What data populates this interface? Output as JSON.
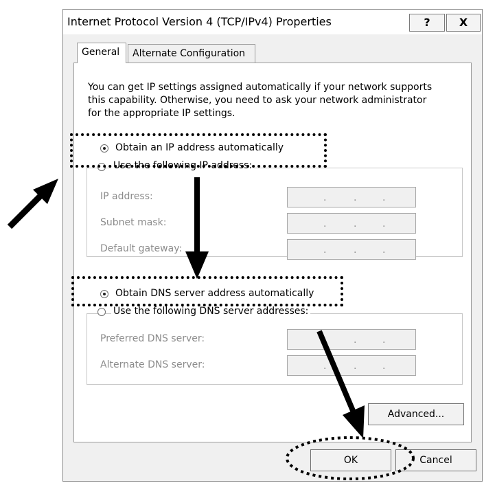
{
  "window": {
    "title": "Internet Protocol Version 4 (TCP/IPv4) Properties",
    "help_label": "?",
    "close_label": "X"
  },
  "tabs": [
    {
      "label": "General",
      "selected": true
    },
    {
      "label": "Alternate Configuration",
      "selected": false
    }
  ],
  "description": [
    "You can get IP settings assigned automatically if your network supports",
    "this capability. Otherwise, you need to ask your network administrator",
    "for the appropriate IP settings."
  ],
  "ip_section": {
    "auto_label": "Obtain an IP address automatically",
    "auto_selected": true,
    "manual_label": "Use the following IP address:",
    "fields": [
      {
        "label": "IP address:",
        "value": ". . ."
      },
      {
        "label": "Subnet mask:",
        "value": ". . ."
      },
      {
        "label": "Default gateway:",
        "value": ". . ."
      }
    ]
  },
  "dns_section": {
    "auto_label": "Obtain DNS server address automatically",
    "auto_selected": true,
    "manual_label": "Use the following DNS server addresses:",
    "fields": [
      {
        "label": "Preferred DNS server:",
        "value": ". . ."
      },
      {
        "label": "Alternate DNS server:",
        "value": ". . ."
      }
    ]
  },
  "buttons": {
    "advanced": "Advanced...",
    "ok": "OK",
    "cancel": "Cancel"
  }
}
